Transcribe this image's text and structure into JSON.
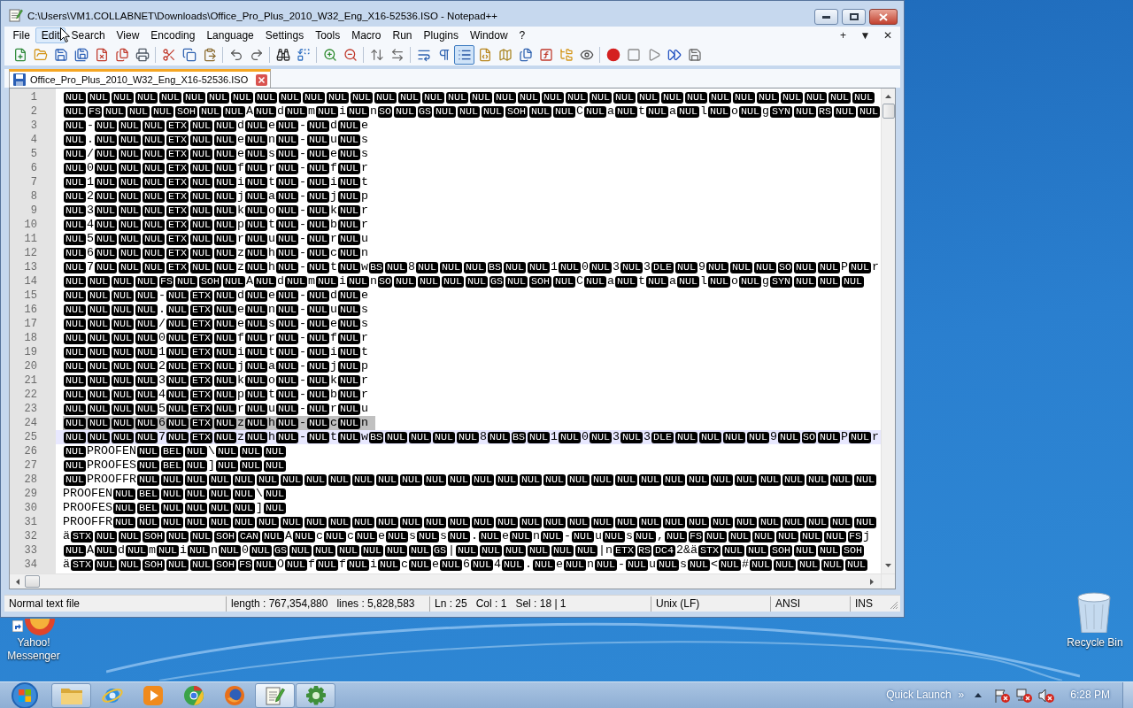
{
  "window": {
    "title": "C:\\Users\\VM1.COLLABNET\\Downloads\\Office_Pro_Plus_2010_W32_Eng_X16-52536.ISO - Notepad++"
  },
  "menu_bar": {
    "items": [
      {
        "label": "File",
        "highlighted": false
      },
      {
        "label": "Edit",
        "highlighted": true
      },
      {
        "label": "Search",
        "highlighted": false
      },
      {
        "label": "View",
        "highlighted": false
      },
      {
        "label": "Encoding",
        "highlighted": false
      },
      {
        "label": "Language",
        "highlighted": false
      },
      {
        "label": "Settings",
        "highlighted": false
      },
      {
        "label": "Tools",
        "highlighted": false
      },
      {
        "label": "Macro",
        "highlighted": false
      },
      {
        "label": "Run",
        "highlighted": false
      },
      {
        "label": "Plugins",
        "highlighted": false
      },
      {
        "label": "Window",
        "highlighted": false
      },
      {
        "label": "?",
        "highlighted": false
      }
    ],
    "right_buttons": [
      "+",
      "▼",
      "✕"
    ]
  },
  "toolbar": [
    [
      {
        "kind": "new",
        "pressed": false
      },
      {
        "kind": "open",
        "pressed": false
      },
      {
        "kind": "save",
        "pressed": false
      },
      {
        "kind": "save_all",
        "pressed": false
      },
      {
        "kind": "close",
        "pressed": false
      },
      {
        "kind": "close_all",
        "pressed": false
      },
      {
        "kind": "print",
        "pressed": false
      }
    ],
    [
      {
        "kind": "cut",
        "pressed": false
      },
      {
        "kind": "copy",
        "pressed": false
      },
      {
        "kind": "paste",
        "pressed": false
      }
    ],
    [
      {
        "kind": "undo",
        "pressed": false
      },
      {
        "kind": "redo",
        "pressed": false
      }
    ],
    [
      {
        "kind": "find",
        "pressed": false
      },
      {
        "kind": "replace",
        "pressed": false
      }
    ],
    [
      {
        "kind": "zoom_in",
        "pressed": false
      },
      {
        "kind": "zoom_out",
        "pressed": false
      }
    ],
    [
      {
        "kind": "sync_v",
        "pressed": false
      },
      {
        "kind": "sync_h",
        "pressed": false
      }
    ],
    [
      {
        "kind": "wrap",
        "pressed": false
      },
      {
        "kind": "all_chars",
        "pressed": false
      },
      {
        "kind": "indent_guide",
        "pressed": true
      },
      {
        "kind": "udl",
        "pressed": false
      },
      {
        "kind": "doc_map",
        "pressed": false
      },
      {
        "kind": "doc_list",
        "pressed": false
      },
      {
        "kind": "function_list",
        "pressed": false
      },
      {
        "kind": "folder_workspace",
        "pressed": false
      },
      {
        "kind": "monitor",
        "pressed": false
      }
    ],
    [
      {
        "kind": "record",
        "pressed": false
      },
      {
        "kind": "stop",
        "pressed": false
      },
      {
        "kind": "play",
        "pressed": false
      },
      {
        "kind": "play_multi",
        "pressed": false
      },
      {
        "kind": "save_macro",
        "pressed": false
      }
    ]
  ],
  "tabs": [
    {
      "label": "Office_Pro_Plus_2010_W32_Eng_X16-52536.ISO",
      "selected": true
    }
  ],
  "editor": {
    "lines": [
      {
        "number": "1",
        "leading_control": true,
        "selected": false,
        "current": false,
        "segments": [
          "NUL NUL NUL NUL NUL NUL NUL NUL NUL NUL NUL NUL NUL NUL NUL NUL NUL NUL NUL NUL NUL NUL NUL NUL NUL NUL NUL NUL NUL NUL NUL NUL NUL NUL"
        ]
      },
      {
        "number": "2",
        "leading_control": true,
        "selected": false,
        "current": false,
        "segments": [
          "NUL FS NUL NUL NUL SOH NUL NUL",
          "A",
          "NUL",
          "d",
          "NUL",
          "m",
          "NUL",
          "i",
          "NUL",
          "n",
          "SO NUL GS NUL NUL NUL SOH NUL NUL",
          "C",
          "NUL",
          "a",
          "NUL",
          "t",
          "NUL",
          "a",
          "NUL",
          "l",
          "NUL",
          "o",
          "NUL",
          "g",
          "SYN NUL RS NUL NUL"
        ]
      },
      {
        "number": "3",
        "leading_control": true,
        "selected": false,
        "current": false,
        "segments": [
          "NUL",
          "-",
          "NUL NUL NUL ETX NUL NUL",
          "d",
          "NUL",
          "e",
          "NUL",
          "-",
          "NUL",
          "d",
          "NUL",
          "e"
        ]
      },
      {
        "number": "4",
        "leading_control": true,
        "selected": false,
        "current": false,
        "segments": [
          "NUL",
          ".",
          "NUL NUL NUL ETX NUL NUL",
          "e",
          "NUL",
          "n",
          "NUL",
          "-",
          "NUL",
          "u",
          "NUL",
          "s"
        ]
      },
      {
        "number": "5",
        "leading_control": true,
        "selected": false,
        "current": false,
        "segments": [
          "NUL",
          "/",
          "NUL NUL NUL ETX NUL NUL",
          "e",
          "NUL",
          "s",
          "NUL",
          "-",
          "NUL",
          "e",
          "NUL",
          "s"
        ]
      },
      {
        "number": "6",
        "leading_control": true,
        "selected": false,
        "current": false,
        "segments": [
          "NUL",
          "0",
          "NUL NUL NUL ETX NUL NUL",
          "f",
          "NUL",
          "r",
          "NUL",
          "-",
          "NUL",
          "f",
          "NUL",
          "r"
        ]
      },
      {
        "number": "7",
        "leading_control": true,
        "selected": false,
        "current": false,
        "segments": [
          "NUL",
          "1",
          "NUL NUL NUL ETX NUL NUL",
          "i",
          "NUL",
          "t",
          "NUL",
          "-",
          "NUL",
          "i",
          "NUL",
          "t"
        ]
      },
      {
        "number": "8",
        "leading_control": true,
        "selected": false,
        "current": false,
        "segments": [
          "NUL",
          "2",
          "NUL NUL NUL ETX NUL NUL",
          "j",
          "NUL",
          "a",
          "NUL",
          "-",
          "NUL",
          "j",
          "NUL",
          "p"
        ]
      },
      {
        "number": "9",
        "leading_control": true,
        "selected": false,
        "current": false,
        "segments": [
          "NUL",
          "3",
          "NUL NUL NUL ETX NUL NUL",
          "k",
          "NUL",
          "o",
          "NUL",
          "-",
          "NUL",
          "k",
          "NUL",
          "r"
        ]
      },
      {
        "number": "10",
        "leading_control": true,
        "selected": false,
        "current": false,
        "segments": [
          "NUL",
          "4",
          "NUL NUL NUL ETX NUL NUL",
          "p",
          "NUL",
          "t",
          "NUL",
          "-",
          "NUL",
          "b",
          "NUL",
          "r"
        ]
      },
      {
        "number": "11",
        "leading_control": true,
        "selected": false,
        "current": false,
        "segments": [
          "NUL",
          "5",
          "NUL NUL NUL ETX NUL NUL",
          "r",
          "NUL",
          "u",
          "NUL",
          "-",
          "NUL",
          "r",
          "NUL",
          "u"
        ]
      },
      {
        "number": "12",
        "leading_control": true,
        "selected": false,
        "current": false,
        "segments": [
          "NUL",
          "6",
          "NUL NUL NUL ETX NUL NUL",
          "z",
          "NUL",
          "h",
          "NUL",
          "-",
          "NUL",
          "c",
          "NUL",
          "n"
        ]
      },
      {
        "number": "13",
        "leading_control": true,
        "selected": false,
        "current": false,
        "segments": [
          "NUL",
          "7",
          "NUL NUL NUL ETX NUL NUL",
          "z",
          "NUL",
          "h",
          "NUL",
          "-",
          "NUL",
          "t",
          "NUL",
          "w",
          "BS NUL",
          "8",
          "NUL NUL NUL BS NUL NUL",
          "1",
          "NUL",
          "0",
          "NUL",
          "3",
          "NUL",
          "3",
          "DLE NUL",
          "9",
          "NUL NUL NUL SO NUL NUL",
          "P",
          "NUL",
          "r"
        ]
      },
      {
        "number": "14",
        "leading_control": true,
        "selected": false,
        "current": false,
        "segments": [
          "NUL NUL NUL NUL FS NUL SOH NUL",
          "A",
          "NUL",
          "d",
          "NUL",
          "m",
          "NUL",
          "i",
          "NUL",
          "n",
          "SO NUL NUL NUL NUL GS NUL SOH NUL",
          "C",
          "NUL",
          "a",
          "NUL",
          "t",
          "NUL",
          "a",
          "NUL",
          "l",
          "NUL",
          "o",
          "NUL",
          "g",
          "SYN NUL NUL NUL"
        ]
      },
      {
        "number": "15",
        "leading_control": true,
        "selected": false,
        "current": false,
        "segments": [
          "NUL NUL NUL NUL",
          "-",
          "NUL ETX NUL",
          "d",
          "NUL",
          "e",
          "NUL",
          "-",
          "NUL",
          "d",
          "NUL",
          "e"
        ]
      },
      {
        "number": "16",
        "leading_control": true,
        "selected": false,
        "current": false,
        "segments": [
          "NUL NUL NUL NUL",
          ".",
          "NUL ETX NUL",
          "e",
          "NUL",
          "n",
          "NUL",
          "-",
          "NUL",
          "u",
          "NUL",
          "s"
        ]
      },
      {
        "number": "17",
        "leading_control": true,
        "selected": false,
        "current": false,
        "segments": [
          "NUL NUL NUL NUL",
          "/",
          "NUL ETX NUL",
          "e",
          "NUL",
          "s",
          "NUL",
          "-",
          "NUL",
          "e",
          "NUL",
          "s"
        ]
      },
      {
        "number": "18",
        "leading_control": true,
        "selected": false,
        "current": false,
        "segments": [
          "NUL NUL NUL NUL",
          "0",
          "NUL ETX NUL",
          "f",
          "NUL",
          "r",
          "NUL",
          "-",
          "NUL",
          "f",
          "NUL",
          "r"
        ]
      },
      {
        "number": "19",
        "leading_control": true,
        "selected": false,
        "current": false,
        "segments": [
          "NUL NUL NUL NUL",
          "1",
          "NUL ETX NUL",
          "i",
          "NUL",
          "t",
          "NUL",
          "-",
          "NUL",
          "i",
          "NUL",
          "t"
        ]
      },
      {
        "number": "20",
        "leading_control": true,
        "selected": false,
        "current": false,
        "segments": [
          "NUL NUL NUL NUL",
          "2",
          "NUL ETX NUL",
          "j",
          "NUL",
          "a",
          "NUL",
          "-",
          "NUL",
          "j",
          "NUL",
          "p"
        ]
      },
      {
        "number": "21",
        "leading_control": true,
        "selected": false,
        "current": false,
        "segments": [
          "NUL NUL NUL NUL",
          "3",
          "NUL ETX NUL",
          "k",
          "NUL",
          "o",
          "NUL",
          "-",
          "NUL",
          "k",
          "NUL",
          "r"
        ]
      },
      {
        "number": "22",
        "leading_control": true,
        "selected": false,
        "current": false,
        "segments": [
          "NUL NUL NUL NUL",
          "4",
          "NUL ETX NUL",
          "p",
          "NUL",
          "t",
          "NUL",
          "-",
          "NUL",
          "b",
          "NUL",
          "r"
        ]
      },
      {
        "number": "23",
        "leading_control": true,
        "selected": false,
        "current": false,
        "segments": [
          "NUL NUL NUL NUL",
          "5",
          "NUL ETX NUL",
          "r",
          "NUL",
          "u",
          "NUL",
          "-",
          "NUL",
          "r",
          "NUL",
          "u"
        ]
      },
      {
        "number": "24",
        "leading_control": true,
        "selected": true,
        "current": false,
        "segments": [
          "NUL NUL NUL NUL",
          "6",
          "NUL ETX NUL",
          "z",
          "NUL",
          "h",
          "NUL",
          "-",
          "NUL",
          "c",
          "NUL",
          "n"
        ]
      },
      {
        "number": "25",
        "leading_control": true,
        "selected": false,
        "current": true,
        "segments": [
          "NUL NUL NUL NUL",
          "7",
          "NUL ETX NUL",
          "z",
          "NUL",
          "h",
          "NUL",
          "-",
          "NUL",
          "t",
          "NUL",
          "w",
          "BS NUL NUL NUL NUL",
          "8",
          "NUL BS NUL",
          "1",
          "NUL",
          "0",
          "NUL",
          "3",
          "NUL",
          "3",
          "DLE NUL NUL NUL NUL",
          "9",
          "NUL SO NUL",
          "P",
          "NUL",
          "r"
        ]
      },
      {
        "number": "26",
        "leading_control": true,
        "selected": false,
        "current": false,
        "segments": [
          "NUL",
          "PROOFEN",
          "NUL BEL NUL",
          "\\",
          "NUL NUL NUL"
        ]
      },
      {
        "number": "27",
        "leading_control": true,
        "selected": false,
        "current": false,
        "segments": [
          "NUL",
          "PROOFES",
          "NUL BEL NUL",
          "]",
          "NUL NUL NUL"
        ]
      },
      {
        "number": "28",
        "leading_control": true,
        "selected": false,
        "current": false,
        "segments": [
          "NUL",
          "PROOFFR",
          "NUL NUL NUL NUL NUL NUL NUL NUL NUL NUL NUL NUL NUL NUL NUL NUL NUL NUL NUL NUL NUL NUL NUL NUL NUL NUL NUL NUL NUL NUL NUL"
        ]
      },
      {
        "number": "29",
        "leading_control": false,
        "selected": false,
        "current": false,
        "segments": [
          "PROOFEN",
          "NUL BEL NUL NUL NUL NUL",
          "\\",
          "NUL"
        ]
      },
      {
        "number": "30",
        "leading_control": false,
        "selected": false,
        "current": false,
        "segments": [
          "PROOFES",
          "NUL BEL NUL NUL NUL NUL",
          "]",
          "NUL"
        ]
      },
      {
        "number": "31",
        "leading_control": false,
        "selected": false,
        "current": false,
        "segments": [
          "PROOFFR",
          "NUL NUL NUL NUL NUL NUL NUL NUL NUL NUL NUL NUL NUL NUL NUL NUL NUL NUL NUL NUL NUL NUL NUL NUL NUL NUL NUL NUL NUL NUL NUL NUL"
        ]
      },
      {
        "number": "32",
        "leading_control": false,
        "selected": false,
        "current": false,
        "segments": [
          "ä",
          "STX NUL NUL SOH NUL NUL SOH CAN NUL",
          "A",
          "NUL",
          "c",
          "NUL",
          "c",
          "NUL",
          "e",
          "NUL",
          "s",
          "NUL",
          "s",
          "NUL",
          ".",
          "NUL",
          "e",
          "NUL",
          "n",
          "NUL",
          "-",
          "NUL",
          "u",
          "NUL",
          "s",
          "NUL",
          ",",
          "NUL FS NUL NUL NUL NUL NUL NUL FS",
          "j"
        ]
      },
      {
        "number": "33",
        "leading_control": true,
        "selected": false,
        "current": false,
        "segments": [
          "NUL",
          "A",
          "NUL",
          "d",
          "NUL",
          "m",
          "NUL",
          "i",
          "NUL",
          "n",
          "NUL",
          "0",
          "NUL GS NUL NUL NUL NUL NUL NUL GS",
          "|",
          "NUL NUL NUL NUL NUL NUL",
          "|n",
          "ETX RS DC4",
          "2&ä",
          "STX NUL NUL SOH NUL NUL SOH"
        ]
      },
      {
        "number": "34",
        "leading_control": false,
        "selected": false,
        "current": false,
        "segments": [
          "ä",
          "STX NUL NUL SOH NUL NUL SOH FS NUL",
          "O",
          "NUL",
          "f",
          "NUL",
          "f",
          "NUL",
          "i",
          "NUL",
          "c",
          "NUL",
          "e",
          "NUL",
          "6",
          "NUL",
          "4",
          "NUL",
          ".",
          "NUL",
          "e",
          "NUL",
          "n",
          "NUL",
          "-",
          "NUL",
          "u",
          "NUL",
          "s",
          "NUL",
          "<",
          "NUL",
          "#",
          "NUL NUL NUL NUL NUL"
        ]
      }
    ]
  },
  "status_bar": [
    {
      "items": [
        "Normal text file"
      ]
    },
    {
      "items": [
        "length : 767,354,880",
        "lines : 5,828,583"
      ]
    },
    {
      "items": [
        "Ln : 25",
        "Col : 1",
        "Sel : 18 | 1"
      ]
    },
    {
      "items": [
        "Unix (LF)"
      ]
    },
    {
      "items": [
        "ANSI"
      ]
    },
    {
      "items": [
        "INS"
      ]
    }
  ],
  "desktop_icons": [
    {
      "kind": "messenger",
      "label": "Yahoo! Messenger"
    },
    {
      "kind": "recycle_bin",
      "label": "Recycle Bin"
    }
  ],
  "taskbar": {
    "apps": [
      {
        "kind": "folder",
        "running": true,
        "active": false
      },
      {
        "kind": "browser_e",
        "running": false,
        "active": false
      },
      {
        "kind": "media",
        "running": false,
        "active": false
      },
      {
        "kind": "chrome",
        "running": false,
        "active": false
      },
      {
        "kind": "firefox",
        "running": false,
        "active": false
      },
      {
        "kind": "notepad",
        "running": true,
        "active": true
      },
      {
        "kind": "tool",
        "running": true,
        "active": false
      }
    ],
    "quick_launch": "Quick Launch",
    "chevron": "»",
    "clock": "6:28 PM"
  }
}
